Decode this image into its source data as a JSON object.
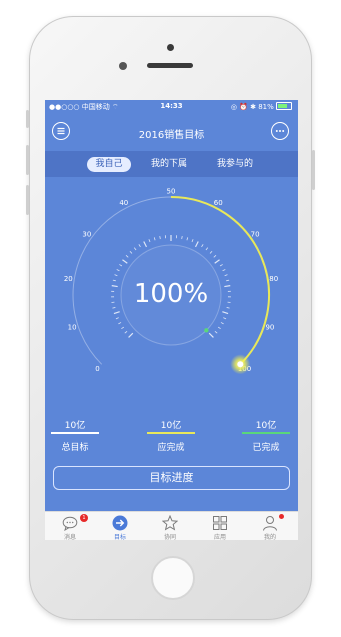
{
  "statusbar": {
    "carrier": "●●○○○ 中国移动 ⌔",
    "time": "14:33",
    "right": "◎ ⏰ ✱ 81%"
  },
  "header": {
    "title": "2016销售目标"
  },
  "tabs": [
    {
      "label": "我自己"
    },
    {
      "label": "我的下属"
    },
    {
      "label": "我参与的"
    }
  ],
  "gauge": {
    "value_text": "100%",
    "progress_percent": 100,
    "scale_min": 0,
    "scale_max": 100,
    "ticks": [
      "0",
      "10",
      "20",
      "30",
      "40",
      "50",
      "60",
      "70",
      "80",
      "90",
      "100"
    ]
  },
  "stats": [
    {
      "value": "10亿",
      "label": "总目标",
      "color": "#ffffff"
    },
    {
      "value": "10亿",
      "label": "应完成",
      "color": "#e8e85a"
    },
    {
      "value": "10亿",
      "label": "已完成",
      "color": "#5ad77a"
    }
  ],
  "progress_button": {
    "label": "目标进度"
  },
  "tabbar": [
    {
      "label": "消息",
      "icon": "chat-bubble-icon",
      "badge": "1"
    },
    {
      "label": "目标",
      "icon": "arrow-circle-icon"
    },
    {
      "label": "协同",
      "icon": "star-icon"
    },
    {
      "label": "应用",
      "icon": "grid-icon"
    },
    {
      "label": "我的",
      "icon": "person-icon"
    }
  ],
  "colors": {
    "accent": "#5c86d8",
    "gauge_arc": "#e8e85a",
    "indicator_dot": "#5ad77a"
  }
}
